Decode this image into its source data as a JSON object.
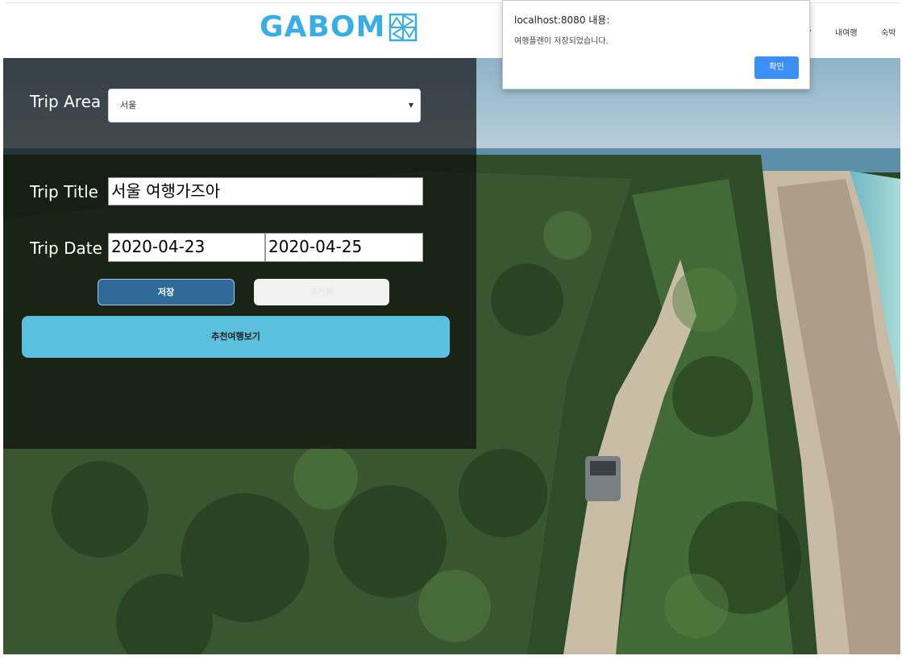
{
  "header": {
    "logo_text": "GABOM",
    "nav": [
      "S",
      "내여행",
      "숙박"
    ]
  },
  "form": {
    "area_label": "Trip Area",
    "area_value": "서울",
    "title_label": "Trip Title",
    "title_value": "서울 여행가즈아",
    "date_label": "Trip Date",
    "start_date": "2020-04-23",
    "end_date": "2020-04-25",
    "save_label": "저장",
    "reset_label": "초기화",
    "recommend_label": "추천여행보기"
  },
  "dialog": {
    "title": "localhost:8080 내용:",
    "message": "여행플랜이 저장되었습니다.",
    "ok_label": "확인"
  },
  "colors": {
    "brand": "#39aee6",
    "save_button": "#2f6a99",
    "recommend_button": "#5bc0de",
    "dialog_button": "#3b8ff5"
  },
  "icons": [
    "pinwheel-icon",
    "chevron-down-icon"
  ]
}
